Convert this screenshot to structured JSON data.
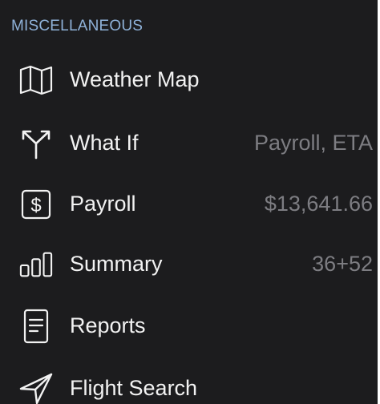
{
  "section": {
    "title": "MISCELLANEOUS"
  },
  "items": [
    {
      "label": "Weather Map",
      "detail": "",
      "icon": "map-icon"
    },
    {
      "label": "What If",
      "detail": "Payroll, ETA",
      "icon": "branch-arrows-icon"
    },
    {
      "label": "Payroll",
      "detail": "$13,641.66",
      "icon": "dollar-sign-icon"
    },
    {
      "label": "Summary",
      "detail": "36+52",
      "icon": "bar-chart-icon"
    },
    {
      "label": "Reports",
      "detail": "",
      "icon": "document-icon"
    },
    {
      "label": "Flight Search",
      "detail": "",
      "icon": "paper-plane-icon"
    }
  ],
  "colors": {
    "background": "#1c1c1e",
    "header": "#8fb2d9",
    "label": "#f2f2f2",
    "detail": "#7d7d82"
  }
}
